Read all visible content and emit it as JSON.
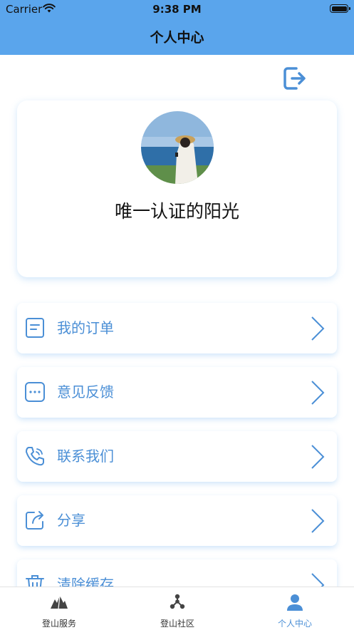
{
  "status_bar": {
    "carrier": "Carrier",
    "time": "9:38 PM"
  },
  "header": {
    "title": "个人中心"
  },
  "profile": {
    "username": "唯一认证的阳光"
  },
  "menu": [
    {
      "label": "我的订单",
      "icon": "order-list-icon"
    },
    {
      "label": "意见反馈",
      "icon": "feedback-chat-icon"
    },
    {
      "label": "联系我们",
      "icon": "phone-call-icon"
    },
    {
      "label": "分享",
      "icon": "share-icon"
    },
    {
      "label": "清除缓存",
      "icon": "trash-icon"
    }
  ],
  "tabbar": {
    "tabs": [
      {
        "label": "登山服务",
        "icon": "mountain-icon"
      },
      {
        "label": "登山社区",
        "icon": "community-nodes-icon"
      },
      {
        "label": "个人中心",
        "icon": "person-icon",
        "active": true
      }
    ]
  },
  "colors": {
    "primary": "#5aa5ec",
    "accent": "#4b8fd6"
  }
}
